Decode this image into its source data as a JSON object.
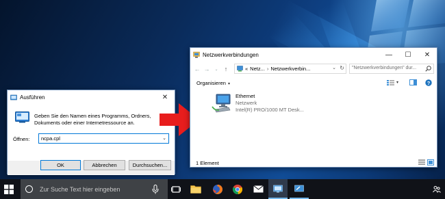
{
  "run_dialog": {
    "title": "Ausführen",
    "description": "Geben Sie den Namen eines Programms, Ordners, Dokuments oder einer Internetressource an.",
    "open_label": "Öffnen:",
    "open_value": "ncpa.cpl",
    "ok_label": "OK",
    "cancel_label": "Abbrechen",
    "browse_label": "Durchsuchen..."
  },
  "explorer": {
    "title": "Netzwerkverbindungen",
    "breadcrumb": {
      "overflow": "«",
      "part1": "Netz...",
      "part2": "Netzwerkverbin..."
    },
    "search_placeholder": "\"Netzwerkverbindungen\" dur...",
    "organize_label": "Organisieren",
    "items": [
      {
        "name": "Ethernet",
        "line2": "Netzwerk",
        "line3": "Intel(R) PRO/1000 MT Desk..."
      }
    ],
    "status_text": "1 Element"
  },
  "taskbar": {
    "search_placeholder": "Zur Suche Text hier eingeben"
  },
  "colors": {
    "accent": "#0078d7",
    "arrow": "#e81d1d",
    "taskbar": "#101218"
  }
}
